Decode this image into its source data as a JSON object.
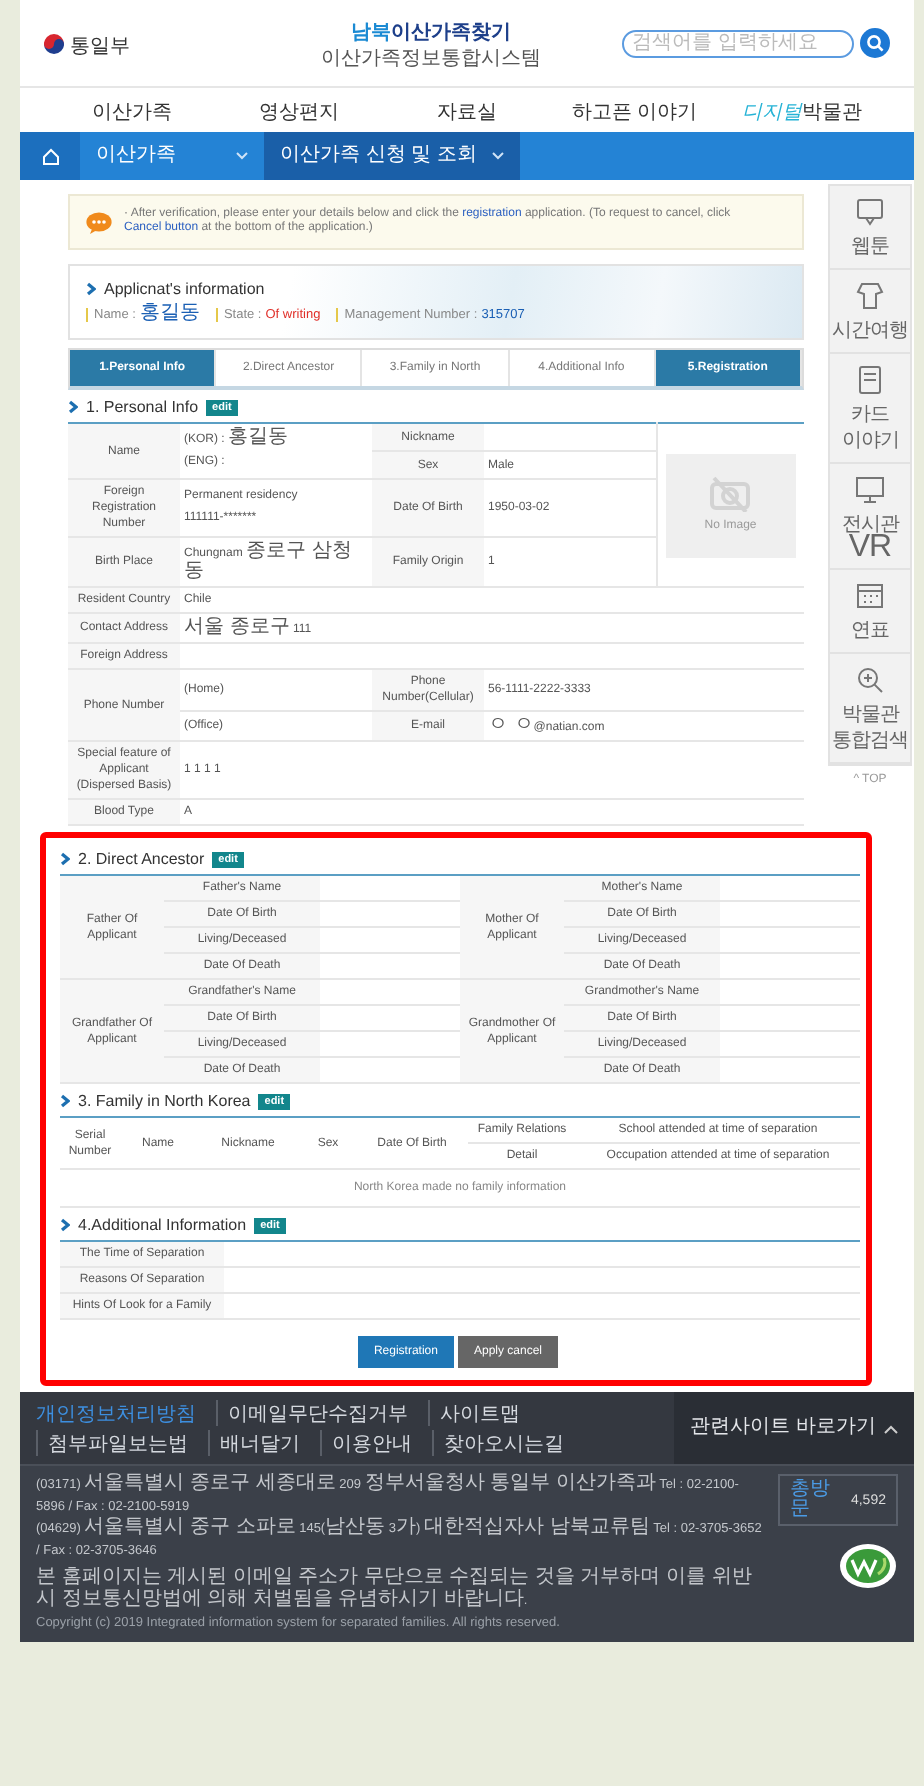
{
  "header": {
    "logo_text": "통일부",
    "title_accent": "남북",
    "title_rest": "이산가족찾기",
    "subtitle": "이산가족정보통합시스템",
    "search": {
      "placeholder": "검색어를 입력하세요"
    }
  },
  "nav": [
    {
      "label": "이산가족"
    },
    {
      "label": "영상편지"
    },
    {
      "label": "자료실"
    },
    {
      "label": "하고픈 이야기"
    },
    {
      "accent": "디지털",
      "label": "박물관"
    }
  ],
  "breadcrumb": [
    {
      "label": "이산가족"
    },
    {
      "label": "이산가족 신청 및 조회"
    }
  ],
  "quick_menu": {
    "items": [
      {
        "kind": "webtoon",
        "label": "웹툰"
      },
      {
        "kind": "time",
        "label": "시간여행"
      },
      {
        "kind": "card",
        "label": "카드 이야기"
      },
      {
        "kind": "vr",
        "label": "전시관 VR"
      },
      {
        "kind": "timeline",
        "label": "연표"
      },
      {
        "kind": "search",
        "label": "박물관 통합검색"
      }
    ],
    "top": "^ TOP"
  },
  "notice": {
    "parts": [
      {
        "kind": "text",
        "text": "· After verification, please enter your details below and click the "
      },
      {
        "kind": "link",
        "text": "registration"
      },
      {
        "kind": "text",
        "text": " application. (To request to cancel, click "
      },
      {
        "kind": "link",
        "text": "Cancel button"
      },
      {
        "kind": "text",
        "text": " at the bottom of the application.)"
      }
    ]
  },
  "applicant": {
    "heading": "Applicnat's information",
    "items": [
      {
        "label": "Name :",
        "value": "홍길동",
        "color": "#1a5fb4"
      },
      {
        "label": "State :",
        "value": "Of writing",
        "color": "#e0302a"
      },
      {
        "label": "Management Number :",
        "value": "315707",
        "color": "#1a5fb4"
      }
    ]
  },
  "steps": [
    {
      "label": "1.Personal Info",
      "selected": true
    },
    {
      "label": "2.Direct Ancestor",
      "selected": false
    },
    {
      "label": "3.Family in North",
      "selected": false
    },
    {
      "label": "4.Additional Info",
      "selected": false
    },
    {
      "label": "5.Registration",
      "selected": true
    }
  ],
  "personal_info": {
    "kind": "personal",
    "heading": "1. Personal Info",
    "badge": "edit",
    "rows": [
      [
        {
          "kind": "label",
          "text": "Name",
          "rowspan": 2
        },
        {
          "kind": "value",
          "lines": [
            "(KOR) : 홍길동",
            "(ENG) :"
          ],
          "rowspan": 2
        },
        {
          "kind": "label",
          "text": "Nickname"
        },
        {
          "kind": "value"
        },
        {
          "kind": "photo",
          "text": "No Image",
          "rowspan": 4
        }
      ],
      [
        {
          "kind": "label",
          "text": "Sex"
        },
        {
          "kind": "value",
          "text": "Male"
        }
      ],
      [
        {
          "kind": "label",
          "text": "Foreign Registration Number"
        },
        {
          "kind": "value",
          "lines": [
            "Permanent residency",
            "111111-*******"
          ]
        },
        {
          "kind": "label",
          "text": "Date Of Birth"
        },
        {
          "kind": "value",
          "text": "1950-03-02"
        }
      ],
      [
        {
          "kind": "label",
          "text": "Birth Place"
        },
        {
          "kind": "value",
          "text": "Chungnam 종로구 삼청동"
        },
        {
          "kind": "label",
          "text": "Family Origin"
        },
        {
          "kind": "value",
          "text": "1"
        }
      ],
      [
        {
          "kind": "label",
          "text": "Resident Country"
        },
        {
          "kind": "value",
          "text": "Chile",
          "colspan": 4
        }
      ],
      [
        {
          "kind": "label",
          "text": "Contact Address"
        },
        {
          "kind": "value",
          "text": "서울 종로구 111",
          "colspan": 4
        }
      ],
      [
        {
          "kind": "label",
          "text": "Foreign Address"
        },
        {
          "kind": "value",
          "colspan": 4
        }
      ],
      [
        {
          "kind": "label",
          "text": "Phone Number",
          "rowspan": 2
        },
        {
          "kind": "value",
          "text": "(Home)"
        },
        {
          "kind": "label",
          "text": "Phone Number(Cellular)"
        },
        {
          "kind": "value",
          "text": "56-1111-2222-3333",
          "colspan": 2
        }
      ],
      [
        {
          "kind": "value",
          "text": "(Office)"
        },
        {
          "kind": "label",
          "text": "E-mail"
        },
        {
          "kind": "value",
          "text": "ㅇ ㅇ@natian.com",
          "colspan": 2
        }
      ],
      [
        {
          "kind": "label",
          "text": "Special feature of Applicant (Dispersed Basis)"
        },
        {
          "kind": "value",
          "text": "1 1 1 1",
          "colspan": 4
        }
      ],
      [
        {
          "kind": "label",
          "text": "Blood Type"
        },
        {
          "kind": "value",
          "text": "A",
          "colspan": 4
        }
      ]
    ]
  },
  "highlighted": {
    "sections": [
      {
        "kind": "ancestor",
        "heading": "2. Direct Ancestor",
        "badge": "edit",
        "rows": [
          [
            {
              "kind": "label",
              "text": "Father Of Applicant",
              "rowspan": 4
            },
            {
              "kind": "label",
              "text": "Father's Name"
            },
            {
              "kind": "value"
            },
            {
              "kind": "label",
              "text": "Mother Of Applicant",
              "rowspan": 4
            },
            {
              "kind": "label",
              "text": "Mother's Name"
            },
            {
              "kind": "value"
            }
          ],
          [
            {
              "kind": "label",
              "text": "Date Of Birth"
            },
            {
              "kind": "value"
            },
            {
              "kind": "label",
              "text": "Date Of Birth"
            },
            {
              "kind": "value"
            }
          ],
          [
            {
              "kind": "label",
              "text": "Living/Deceased"
            },
            {
              "kind": "value"
            },
            {
              "kind": "label",
              "text": "Living/Deceased"
            },
            {
              "kind": "value"
            }
          ],
          [
            {
              "kind": "label",
              "text": "Date Of Death"
            },
            {
              "kind": "value"
            },
            {
              "kind": "label",
              "text": "Date Of Death"
            },
            {
              "kind": "value"
            }
          ],
          [
            {
              "kind": "label",
              "text": "Grandfather Of Applicant",
              "rowspan": 4
            },
            {
              "kind": "label",
              "text": "Grandfather's Name"
            },
            {
              "kind": "value"
            },
            {
              "kind": "label",
              "text": "Grandmother Of Applicant",
              "rowspan": 4
            },
            {
              "kind": "label",
              "text": "Grandmother's Name"
            },
            {
              "kind": "value"
            }
          ],
          [
            {
              "kind": "label",
              "text": "Date Of Birth"
            },
            {
              "kind": "value"
            },
            {
              "kind": "label",
              "text": "Date Of Birth"
            },
            {
              "kind": "value"
            }
          ],
          [
            {
              "kind": "label",
              "text": "Living/Deceased"
            },
            {
              "kind": "value"
            },
            {
              "kind": "label",
              "text": "Living/Deceased"
            },
            {
              "kind": "value"
            }
          ],
          [
            {
              "kind": "label",
              "text": "Date Of Death"
            },
            {
              "kind": "value"
            },
            {
              "kind": "label",
              "text": "Date Of Death"
            },
            {
              "kind": "value"
            }
          ]
        ]
      },
      {
        "kind": "family",
        "heading": "3. Family in North Korea",
        "badge": "edit",
        "rows": [
          [
            {
              "kind": "head",
              "text": "Serial Number",
              "rowspan": 2
            },
            {
              "kind": "head",
              "text": "Name",
              "rowspan": 2
            },
            {
              "kind": "head",
              "text": "Nickname",
              "rowspan": 2
            },
            {
              "kind": "head",
              "text": "Sex",
              "rowspan": 2
            },
            {
              "kind": "head",
              "text": "Date Of Birth",
              "rowspan": 2
            },
            {
              "kind": "head",
              "text": "Family Relations"
            },
            {
              "kind": "head",
              "text": "School attended at time of separation"
            }
          ],
          [
            {
              "kind": "head",
              "text": "Detail"
            },
            {
              "kind": "head",
              "text": "Occupation attended at time of separation"
            }
          ],
          [
            {
              "kind": "message",
              "text": "North Korea made no family information",
              "colspan": 7
            }
          ]
        ]
      },
      {
        "kind": "additional",
        "heading": "4.Additional Information",
        "badge": "edit",
        "rows": [
          [
            {
              "kind": "label",
              "text": "The Time of Separation"
            },
            {
              "kind": "value"
            }
          ],
          [
            {
              "kind": "label",
              "text": "Reasons Of Separation"
            },
            {
              "kind": "value"
            }
          ],
          [
            {
              "kind": "label",
              "text": "Hints Of Look for a Family"
            },
            {
              "kind": "value"
            }
          ]
        ]
      }
    ],
    "buttons": [
      {
        "kind": "primary",
        "label": "Registration"
      },
      {
        "kind": "secondary",
        "label": "Apply cancel"
      }
    ]
  },
  "footer": {
    "links": [
      {
        "label": "개인정보처리방침",
        "color": "#3d8fe0"
      },
      {
        "label": "이메일무단수집거부",
        "color": "#d5d9df"
      },
      {
        "label": "사이트맵",
        "color": "#d5d9df"
      },
      {
        "label": "첨부파일보는법",
        "color": "#d5d9df"
      },
      {
        "label": "배너달기",
        "color": "#d5d9df"
      },
      {
        "label": "이용안내",
        "color": "#d5d9df"
      },
      {
        "label": "찾아오시는길",
        "color": "#d5d9df"
      }
    ],
    "related": "관련사이트 바로가기",
    "address_lines": [
      "(03171) 서울특별시 종로구 세종대로 209 정부서울청사 통일부 이산가족과 Tel : 02-2100-5896 / Fax : 02-2100-5919",
      "(04629) 서울특별시 중구 소파로 145(남산동 3가) 대한적십자사 남북교류팀 Tel : 02-3705-3652 / Fax : 02-3705-3646"
    ],
    "notice": "본 홈페이지는 게시된 이메일 주소가 무단으로 수집되는 것을 거부하며 이를 위반 시 정보통신망법에 의해 처벌됨을 유념하시기 바랍니다.",
    "copyright": "Copyright (c) 2019 Integrated information system for separated families. All rights reserved.",
    "visits": {
      "label": "총방문",
      "value": "4,592"
    }
  }
}
